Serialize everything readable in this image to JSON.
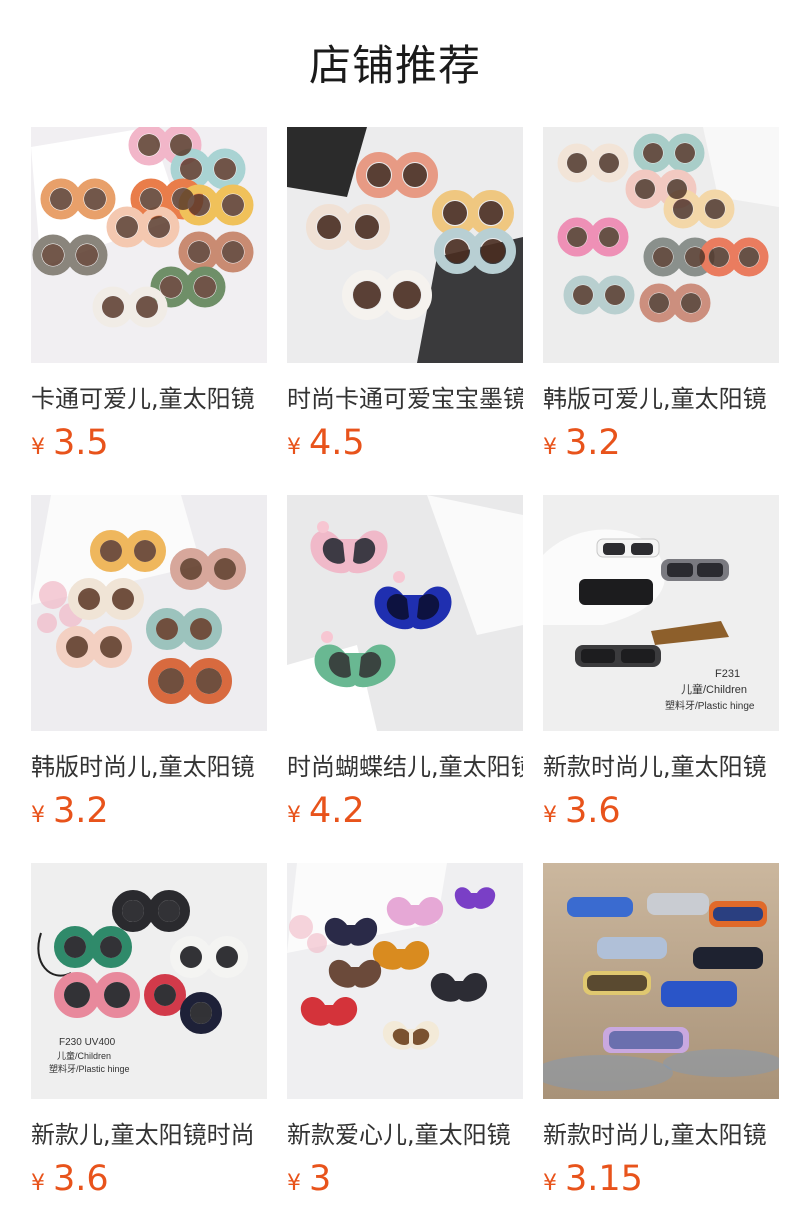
{
  "shop": {
    "title": "店铺推荐"
  },
  "products": [
    {
      "name": "卡通可爱儿,童太阳镜",
      "currency": "¥",
      "price": "3.5"
    },
    {
      "name": "时尚卡通可爱宝宝墨镜",
      "currency": "¥",
      "price": "4.5"
    },
    {
      "name": "韩版可爱儿,童太阳镜",
      "currency": "¥",
      "price": "3.2"
    },
    {
      "name": "韩版时尚儿,童太阳镜",
      "currency": "¥",
      "price": "3.2"
    },
    {
      "name": "时尚蝴蝶结儿,童太阳镜",
      "currency": "¥",
      "price": "4.2"
    },
    {
      "name": "新款时尚儿,童太阳镜",
      "currency": "¥",
      "price": "3.6",
      "image_text": [
        "F231",
        "儿童/Children",
        "塑料牙/Plastic hinge"
      ]
    },
    {
      "name": "新款儿,童太阳镜时尚",
      "currency": "¥",
      "price": "3.6",
      "image_text": [
        "F230 UV400",
        "儿童/Children",
        "塑料牙/Plastic hinge"
      ]
    },
    {
      "name": "新款爱心儿,童太阳镜",
      "currency": "¥",
      "price": "3"
    },
    {
      "name": "新款时尚儿,童太阳镜",
      "currency": "¥",
      "price": "3.15"
    }
  ]
}
